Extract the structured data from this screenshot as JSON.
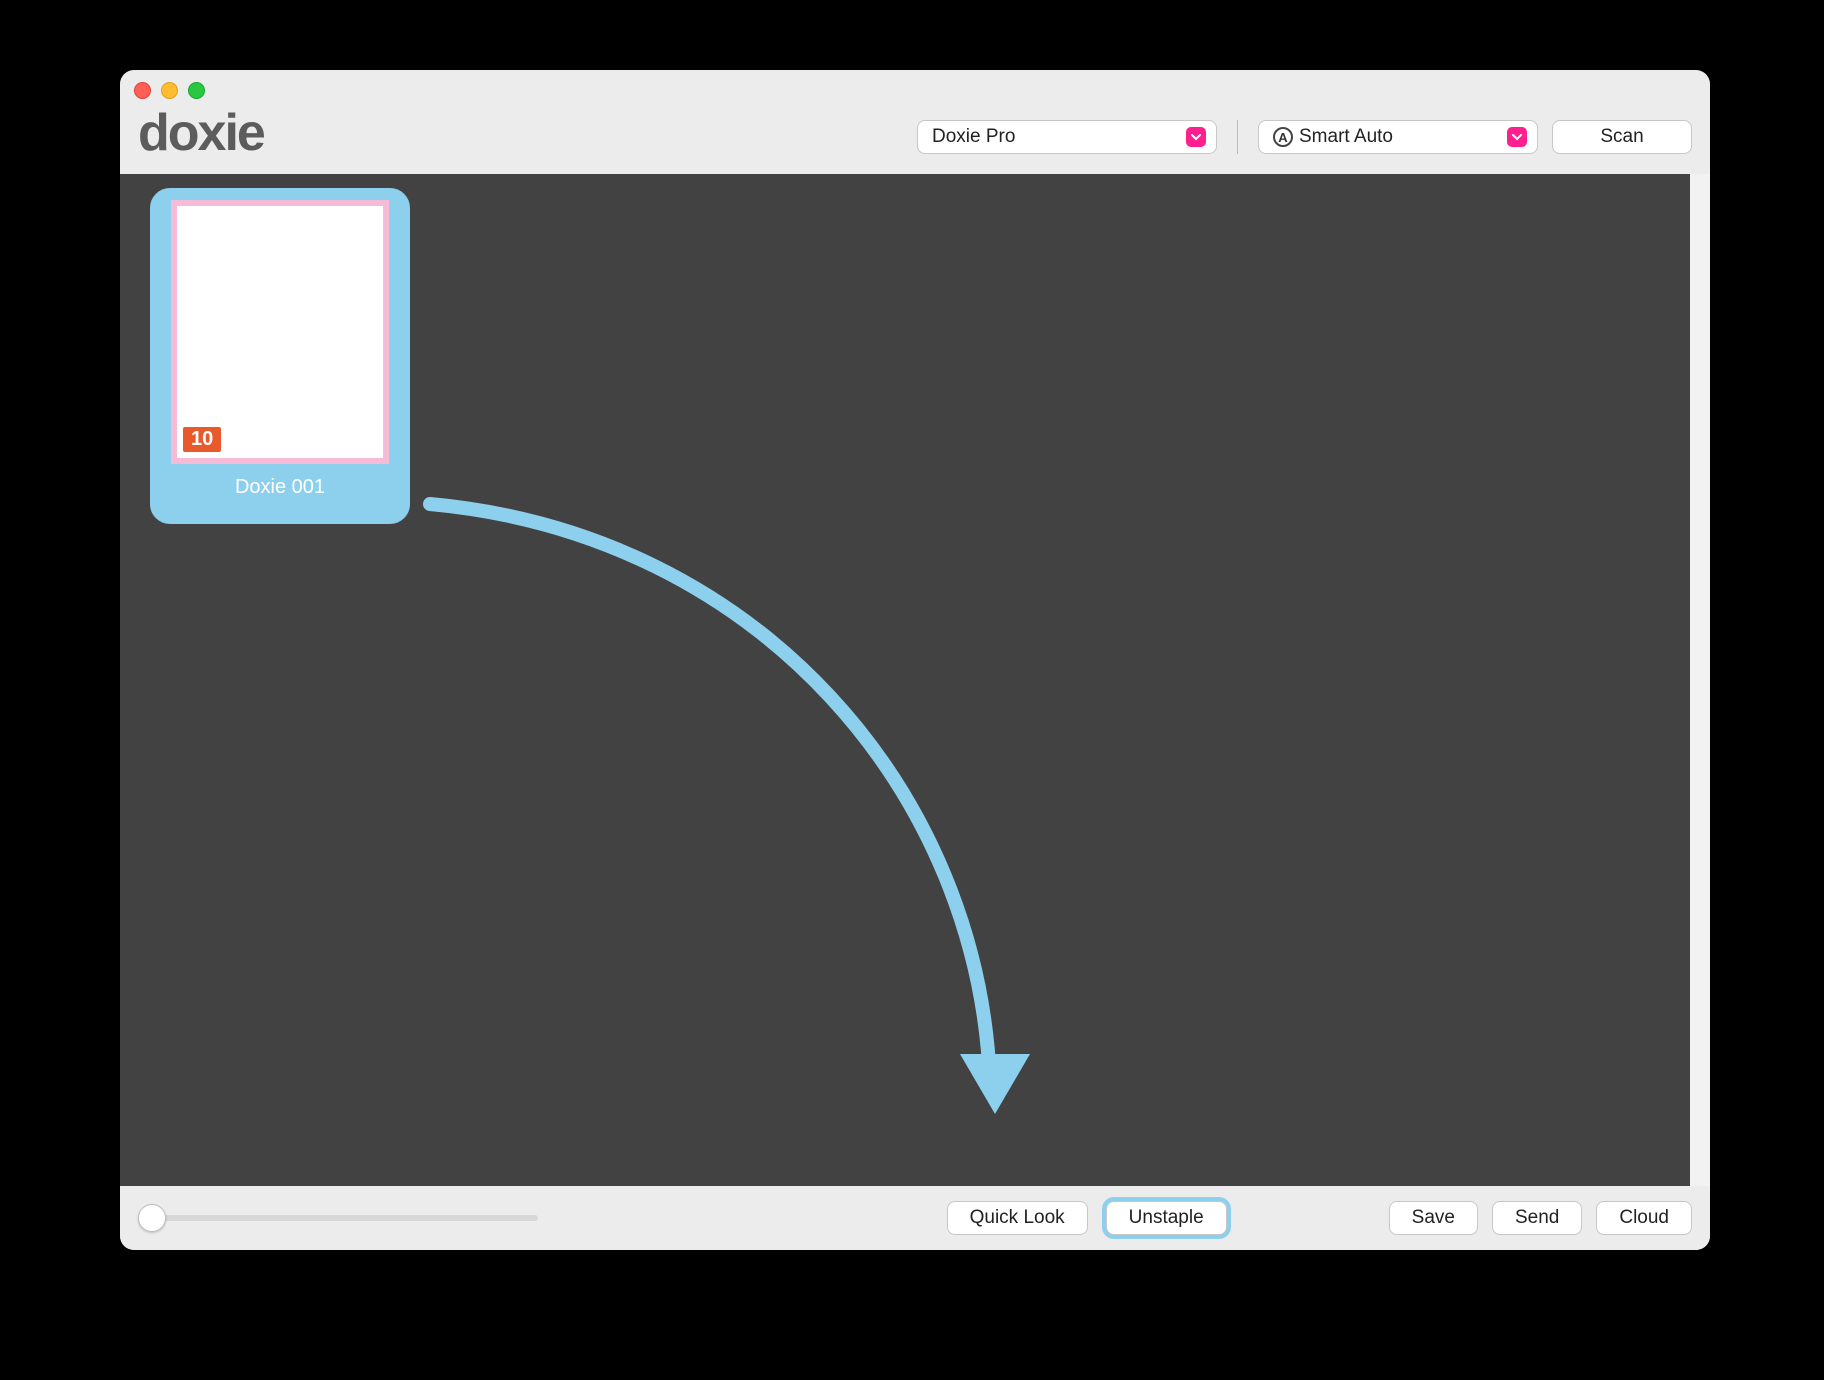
{
  "app": {
    "name": "doxie"
  },
  "toolbar": {
    "scanner_dropdown": "Doxie Pro",
    "mode_dropdown": "Smart Auto",
    "scan_button": "Scan"
  },
  "content": {
    "thumbnail": {
      "label": "Doxie 001",
      "page_count": "10"
    }
  },
  "footer": {
    "quick_look": "Quick Look",
    "unstaple": "Unstaple",
    "save": "Save",
    "send": "Send",
    "cloud": "Cloud"
  },
  "colors": {
    "highlight": "#8dd0ee",
    "pink_border": "#f6bcd7",
    "badge": "#e85a2c",
    "accent": "#ff1f8f"
  }
}
